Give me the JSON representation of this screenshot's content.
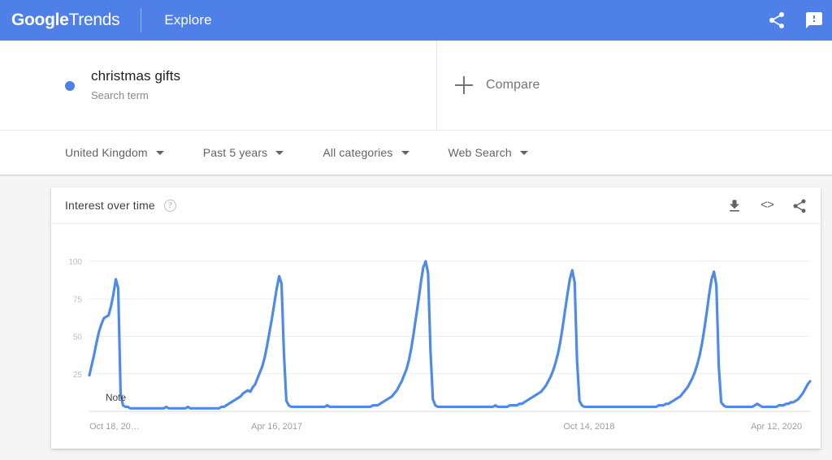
{
  "appbar": {
    "brand_bold": "Google",
    "brand_light": "Trends",
    "explore_label": "Explore",
    "share_icon": "share-icon",
    "feedback_icon": "feedback-icon",
    "background_color": "#4f80e8"
  },
  "query": {
    "term": "christmas gifts",
    "type_label": "Search term",
    "dot_color": "#4f80e8",
    "compare_label": "Compare",
    "compare_icon": "plus-icon"
  },
  "filters": [
    {
      "label": "United Kingdom",
      "name": "filter-location"
    },
    {
      "label": "Past 5 years",
      "name": "filter-time-range"
    },
    {
      "label": "All categories",
      "name": "filter-category"
    },
    {
      "label": "Web Search",
      "name": "filter-search-type"
    }
  ],
  "card": {
    "title": "Interest over time",
    "help_icon": "help-icon",
    "help_glyph": "?",
    "download_icon": "download-icon",
    "embed_icon": "embed-icon",
    "embed_glyph": "<>",
    "share_icon": "share-icon"
  },
  "chart_data": {
    "type": "line",
    "title": "Interest over time",
    "xlabel": "",
    "ylabel": "",
    "ylim": [
      0,
      100
    ],
    "grid": true,
    "legend": false,
    "line_color": "#4f8ae8",
    "annotations": [
      {
        "label": "Note",
        "x_index": 11,
        "y": 6
      }
    ],
    "y_ticks": [
      25,
      50,
      75,
      100
    ],
    "x_tick_labels": [
      "Oct 18, 20…",
      "Apr 16, 2017",
      "Oct 14, 2018",
      "Apr 12, 2020"
    ],
    "x_tick_indices": [
      0,
      78,
      208,
      286
    ],
    "series_name": "christmas gifts",
    "values": [
      24,
      31,
      38,
      46,
      53,
      58,
      62,
      63,
      64,
      70,
      78,
      88,
      82,
      12,
      4,
      3,
      3,
      2,
      2,
      2,
      2,
      2,
      2,
      2,
      2,
      2,
      2,
      2,
      2,
      2,
      2,
      2,
      3,
      2,
      2,
      2,
      2,
      2,
      2,
      2,
      2,
      3,
      2,
      2,
      2,
      2,
      2,
      2,
      2,
      2,
      2,
      2,
      2,
      2,
      2,
      3,
      3,
      4,
      5,
      6,
      7,
      8,
      9,
      10,
      12,
      13,
      14,
      13,
      16,
      18,
      22,
      26,
      30,
      36,
      44,
      53,
      62,
      72,
      82,
      90,
      85,
      38,
      7,
      4,
      3,
      3,
      3,
      3,
      3,
      3,
      3,
      3,
      3,
      3,
      3,
      3,
      3,
      3,
      3,
      4,
      3,
      3,
      3,
      3,
      3,
      3,
      3,
      3,
      3,
      3,
      3,
      3,
      3,
      3,
      3,
      3,
      3,
      3,
      4,
      4,
      4,
      5,
      6,
      7,
      8,
      9,
      10,
      12,
      14,
      17,
      20,
      24,
      28,
      34,
      42,
      52,
      63,
      74,
      86,
      96,
      100,
      92,
      40,
      8,
      4,
      3,
      3,
      3,
      3,
      3,
      3,
      3,
      3,
      3,
      3,
      3,
      3,
      3,
      3,
      3,
      3,
      3,
      3,
      3,
      3,
      3,
      3,
      3,
      3,
      4,
      3,
      3,
      3,
      3,
      3,
      4,
      4,
      4,
      4,
      5,
      5,
      6,
      7,
      8,
      9,
      10,
      11,
      12,
      13,
      15,
      17,
      20,
      23,
      27,
      32,
      38,
      46,
      56,
      67,
      78,
      88,
      94,
      86,
      34,
      7,
      4,
      3,
      3,
      3,
      3,
      3,
      3,
      3,
      3,
      3,
      3,
      3,
      3,
      3,
      3,
      3,
      3,
      3,
      3,
      3,
      3,
      3,
      3,
      3,
      3,
      3,
      3,
      3,
      3,
      3,
      3,
      3,
      4,
      4,
      4,
      5,
      5,
      6,
      7,
      8,
      9,
      10,
      12,
      14,
      16,
      19,
      22,
      26,
      31,
      37,
      45,
      55,
      66,
      78,
      88,
      93,
      84,
      30,
      6,
      4,
      3,
      3,
      3,
      3,
      3,
      3,
      3,
      3,
      3,
      3,
      3,
      3,
      4,
      5,
      4,
      3,
      3,
      3,
      3,
      3,
      3,
      3,
      4,
      4,
      4,
      5,
      5,
      6,
      6,
      7,
      8,
      10,
      12,
      15,
      18,
      20
    ]
  }
}
